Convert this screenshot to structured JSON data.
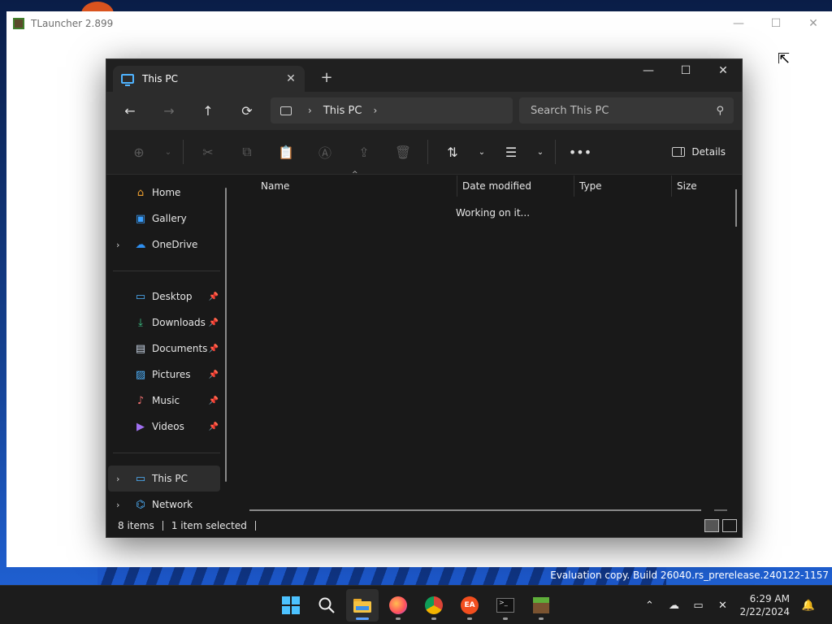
{
  "tlauncher": {
    "title": "TLauncher 2.899"
  },
  "explorer": {
    "tab_title": "This PC",
    "tab_close": "✕",
    "new_tab": "+",
    "window_controls": {
      "minimize": "—",
      "maximize": "☐",
      "close": "✕"
    },
    "nav": {
      "back": "←",
      "forward": "→",
      "up": "↑",
      "refresh": "⟳"
    },
    "address": {
      "chevron": "›",
      "crumb": "This PC",
      "trailing_chevron": "›"
    },
    "search": {
      "placeholder": "Search This PC",
      "icon": "⚲"
    },
    "command_bar": {
      "new": "⊕",
      "new_drop": "⌄",
      "cut": "✂",
      "copy": "⧉",
      "paste": "📋",
      "rename": "Ⓐ",
      "share": "⇪",
      "delete": "🗑",
      "sort": "⇅",
      "sort_drop": "⌄",
      "view": "☰",
      "view_drop": "⌄",
      "more": "•••",
      "details_label": "Details"
    },
    "sidebar": {
      "quick": [
        {
          "label": "Home",
          "icon": "⌂",
          "color": "#f0a030"
        },
        {
          "label": "Gallery",
          "icon": "▣",
          "color": "#3aa0ff"
        },
        {
          "label": "OneDrive",
          "icon": "☁",
          "color": "#2e8ff0",
          "expander": "›"
        }
      ],
      "pinned": [
        {
          "label": "Desktop",
          "icon": "▭",
          "color": "#4fb3ff",
          "pin": "📌"
        },
        {
          "label": "Downloads",
          "icon": "⤓",
          "color": "#3cc98a",
          "pin": "📌"
        },
        {
          "label": "Documents",
          "icon": "▤",
          "color": "#c8d4e6",
          "pin": "📌"
        },
        {
          "label": "Pictures",
          "icon": "▨",
          "color": "#4fb3ff",
          "pin": "📌"
        },
        {
          "label": "Music",
          "icon": "♪",
          "color": "#f07070",
          "pin": "📌"
        },
        {
          "label": "Videos",
          "icon": "▶",
          "color": "#a070f0",
          "pin": "📌"
        }
      ],
      "drives": [
        {
          "label": "This PC",
          "icon": "▭",
          "color": "#4fb3ff",
          "expander": "›",
          "selected": true
        },
        {
          "label": "Network",
          "icon": "⌬",
          "color": "#4fb3ff",
          "expander": "›"
        }
      ]
    },
    "columns": {
      "name": "Name",
      "date": "Date modified",
      "type": "Type",
      "size": "Size",
      "sort_caret": "^"
    },
    "status_message": "Working on it...",
    "statusbar": {
      "items": "8 items",
      "selection": "1 item selected"
    }
  },
  "watermark": "Evaluation copy. Build 26040.rs_prerelease.240122-1157",
  "taskbar": {
    "apps": [
      {
        "name": "start",
        "active": false
      },
      {
        "name": "search",
        "active": false
      },
      {
        "name": "file-explorer",
        "active": true
      },
      {
        "name": "firefox",
        "active": false
      },
      {
        "name": "chrome",
        "active": false
      },
      {
        "name": "ea",
        "active": false
      },
      {
        "name": "terminal",
        "active": false
      },
      {
        "name": "minecraft",
        "active": false
      }
    ],
    "tray": {
      "chevron": "⌃",
      "time": "6:29 AM",
      "date": "2/22/2024",
      "bell": "🔔"
    }
  },
  "colors": {
    "accent": "#4cc2ff",
    "explorer_bg": "#191919",
    "taskbar_bg": "#1c1c1c"
  }
}
